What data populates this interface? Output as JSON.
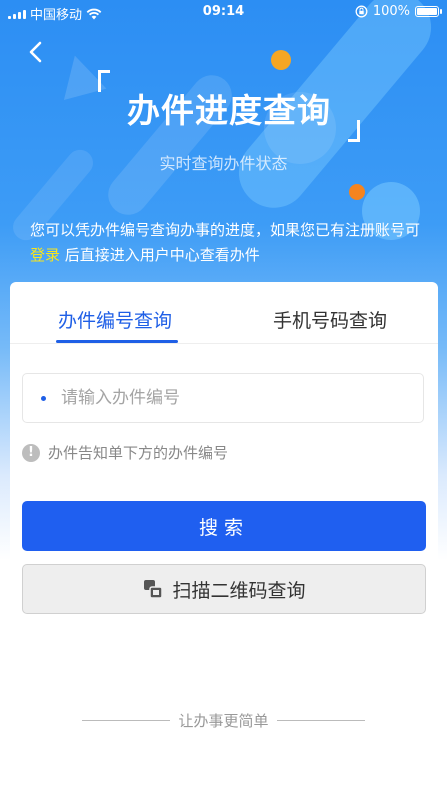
{
  "status_bar": {
    "carrier": "中国移动",
    "time": "09:14",
    "battery": "100%",
    "battery_level": 1.0
  },
  "header": {
    "title": "办件进度查询",
    "subtitle": "实时查询办件状态"
  },
  "intro": {
    "text_before": "您可以凭办件编号查询办事的进度，如果您已有注册账号可",
    "login_link": "登录",
    "text_after": "后直接进入用户中心查看办件"
  },
  "tabs": [
    {
      "label": "办件编号查询",
      "active": true
    },
    {
      "label": "手机号码查询",
      "active": false
    }
  ],
  "form": {
    "input_placeholder": "请输入办件编号",
    "input_value": "",
    "hint": "办件告知单下方的办件编号",
    "search_label": "搜索",
    "scan_label": "扫描二维码查询"
  },
  "footer": {
    "slogan": "让办事更简单"
  },
  "colors": {
    "primary": "#1f5ff0",
    "link": "#f7e51e",
    "accent_orange": "#f5a623"
  },
  "icons": {
    "back": "chevron-left-icon",
    "wifi": "wifi-icon",
    "lock": "rotation-lock-icon",
    "hint": "exclamation-icon",
    "scan": "qr-scan-icon"
  }
}
